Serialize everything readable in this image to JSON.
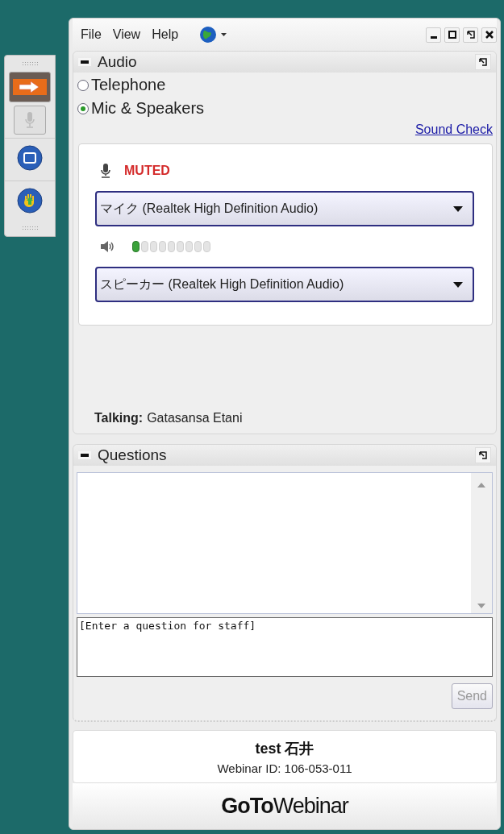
{
  "menu": [
    "File",
    "View",
    "Help"
  ],
  "audio": {
    "title": "Audio",
    "options": [
      {
        "label": "Telephone",
        "selected": false
      },
      {
        "label": "Mic & Speakers",
        "selected": true
      }
    ],
    "sound_check": "Sound Check",
    "status": "MUTED",
    "microphone": "マイク (Realtek High Definition Audio)",
    "mic_level": {
      "level": 0.11
    },
    "speaker": "スピーカー (Realtek High Definition Audio)",
    "talking_label": "Talking:",
    "talking_name": "Gatasansa Etani"
  },
  "questions": {
    "title": "Questions",
    "placeholder": "[Enter a question for staff]",
    "send": "Send",
    "send_disabled": true
  },
  "footer": {
    "name": "test 石井",
    "webinar_id": "Webinar ID: 106-053-011",
    "logo": "**GoTo**Webinar"
  }
}
